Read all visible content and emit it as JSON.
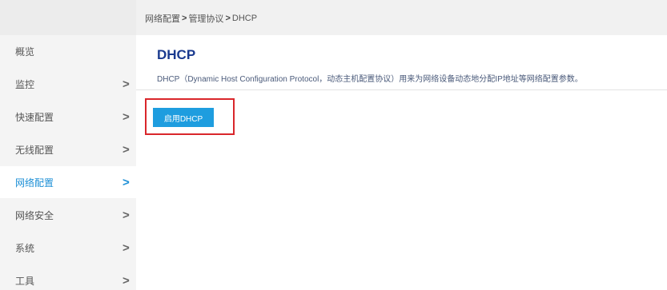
{
  "breadcrumb": {
    "items": [
      "网络配置",
      "管理协议",
      "DHCP"
    ],
    "separator": ">"
  },
  "sidebar": {
    "items": [
      {
        "label": "概览",
        "has_arrow": false,
        "active": false
      },
      {
        "label": "监控",
        "has_arrow": true,
        "active": false
      },
      {
        "label": "快速配置",
        "has_arrow": true,
        "active": false
      },
      {
        "label": "无线配置",
        "has_arrow": true,
        "active": false
      },
      {
        "label": "网络配置",
        "has_arrow": true,
        "active": true
      },
      {
        "label": "网络安全",
        "has_arrow": true,
        "active": false
      },
      {
        "label": "系统",
        "has_arrow": true,
        "active": false
      },
      {
        "label": "工具",
        "has_arrow": true,
        "active": false
      }
    ],
    "arrow_glyph": ">"
  },
  "main": {
    "title": "DHCP",
    "description": "DHCP（Dynamic Host Configuration Protocol，动态主机配置协议）用来为网络设备动态地分配IP地址等网络配置参数。",
    "enable_button_label": "启用DHCP"
  },
  "colors": {
    "accent": "#1c8fd6",
    "button": "#1e9ddf",
    "highlight": "#d9262b",
    "title": "#1a3a8f"
  }
}
